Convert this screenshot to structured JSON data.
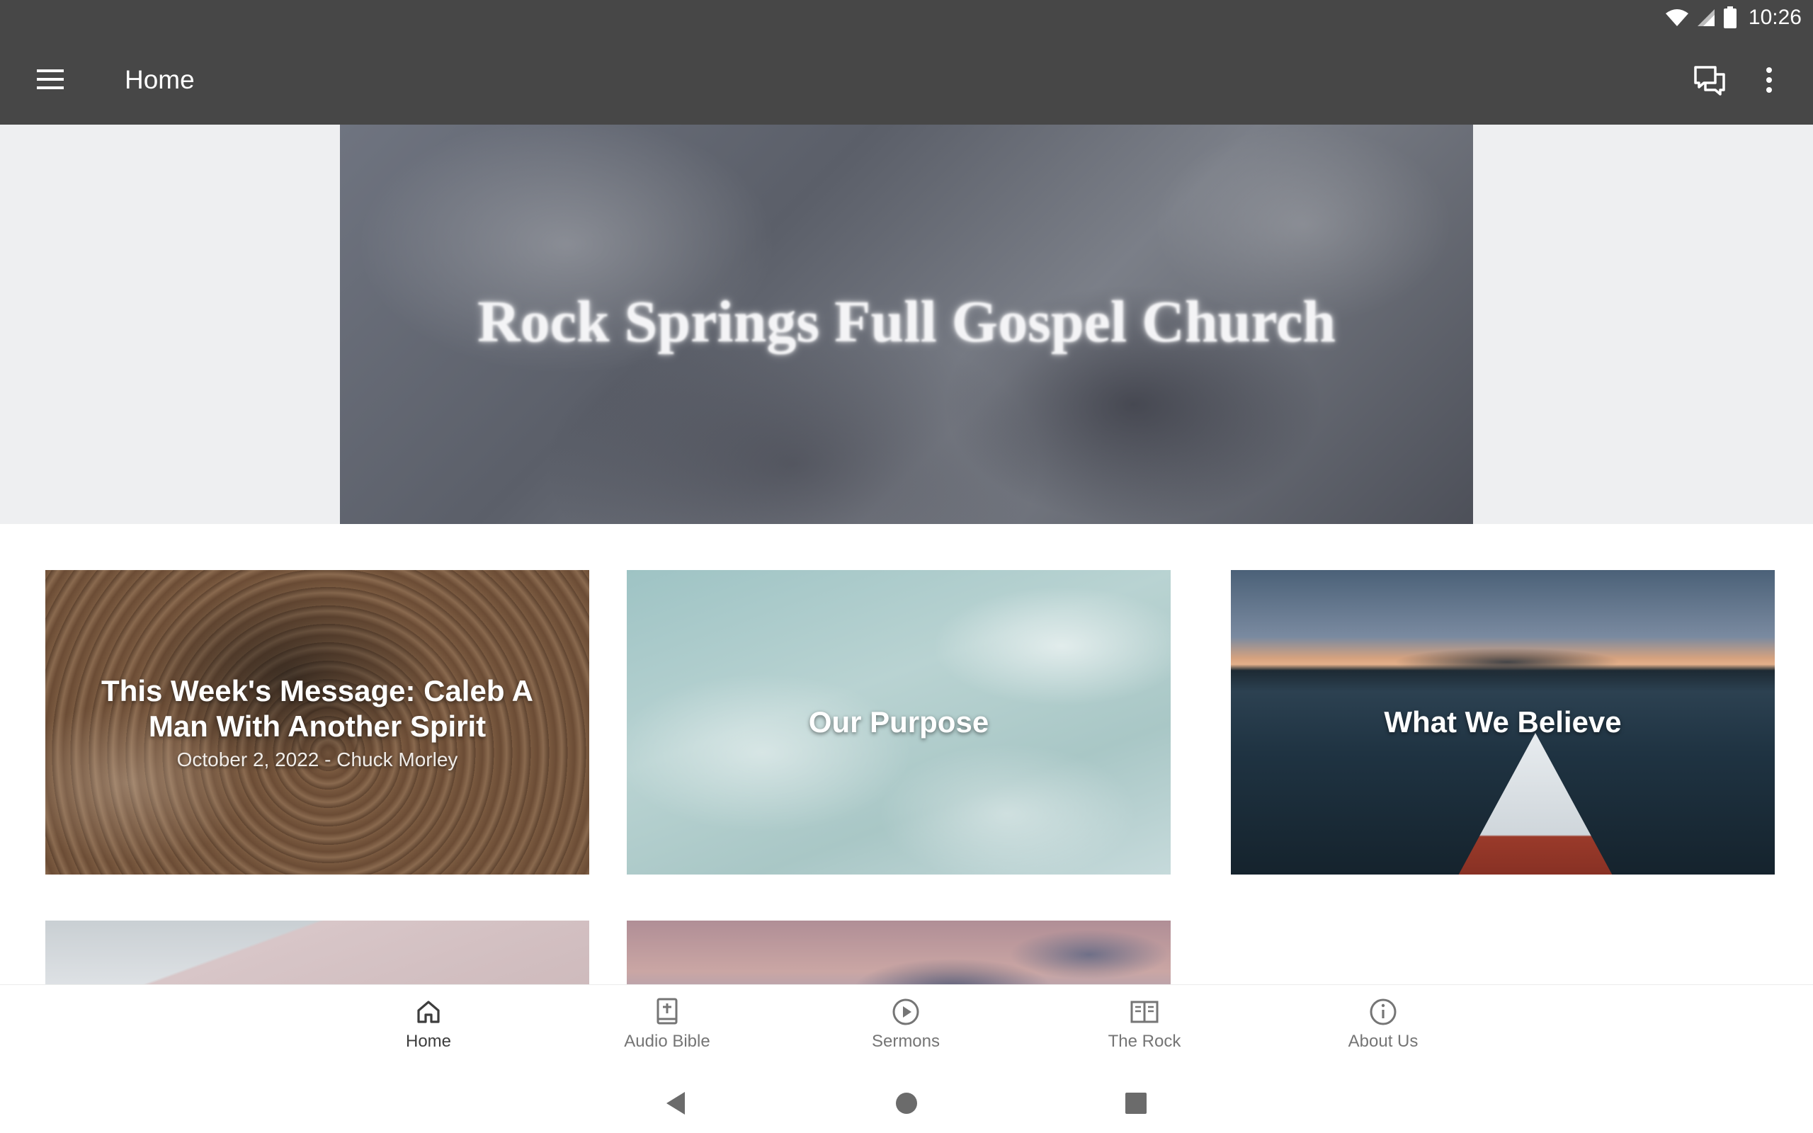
{
  "status_bar": {
    "time": "10:26",
    "icons": [
      "wifi-icon",
      "signal-icon",
      "battery-icon"
    ]
  },
  "app_bar": {
    "title": "Home",
    "icons": [
      "menu-icon",
      "chat-icon",
      "more-vert-icon"
    ]
  },
  "hero": {
    "title": "Rock Springs Full Gospel Church"
  },
  "cards": [
    {
      "title": "This Week's Message: Caleb A Man With Another Spirit",
      "subtitle": "October 2, 2022 - Chuck Morley"
    },
    {
      "title": "Our Purpose"
    },
    {
      "title": "What We Believe"
    }
  ],
  "bottom_nav": {
    "active": "Home",
    "items": [
      {
        "label": "Home",
        "icon": "home-icon"
      },
      {
        "label": "Audio Bible",
        "icon": "bible-icon"
      },
      {
        "label": "Sermons",
        "icon": "play-circle-icon"
      },
      {
        "label": "The Rock",
        "icon": "book-open-icon"
      },
      {
        "label": "About Us",
        "icon": "info-icon"
      }
    ]
  },
  "system_nav": [
    "back-icon",
    "home-circle-icon",
    "recents-icon"
  ],
  "colors": {
    "app_bar": "#474747",
    "hero_band": "#eeeff1",
    "nav_active": "#3d3d3d",
    "nav_inactive": "#757575"
  }
}
